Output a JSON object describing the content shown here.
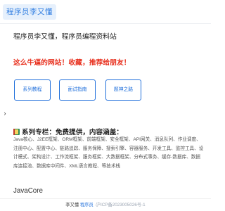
{
  "header": {
    "logo_text": "程序员李又懂"
  },
  "main": {
    "intro": "程序员李又懂，程序员编程资料站",
    "promo": "这么牛逼的网站！收藏，推荐给朋友！",
    "buttons": [
      {
        "label": "系列教程"
      },
      {
        "label": "面试指南"
      },
      {
        "label": "题神之路"
      }
    ],
    "topics": {
      "title": "系列专栏：免费提供，内容涵盖：",
      "body": "Java核心、J2EE框架、ORM框架、前端框架、安全框架、API网关、消息队列、作业调度、注册中心、配置中心、链路追踪、服务保障、搜索引擎、容器服务、开发工具、监控工具、设计模式、架构设计、工作流框架、服务框架、大数据框架、分布式事务、缓存-数据库、数据库连接池、数据库中间件、XML语言教程、等技术栈"
    },
    "section_title": "JavaCore"
  },
  "footer": {
    "author": "李又懂",
    "site": "程序员",
    "icp": "-沪ICP备2023005026号-1"
  },
  "icons": {
    "side_toggle": "chevron-right-icon",
    "topic_icon": "book-icon"
  },
  "colors": {
    "brand": "#2f7de1",
    "link": "#1f6fdb",
    "promo": "#e8311f",
    "logo_bg": "#e6f0fc"
  }
}
